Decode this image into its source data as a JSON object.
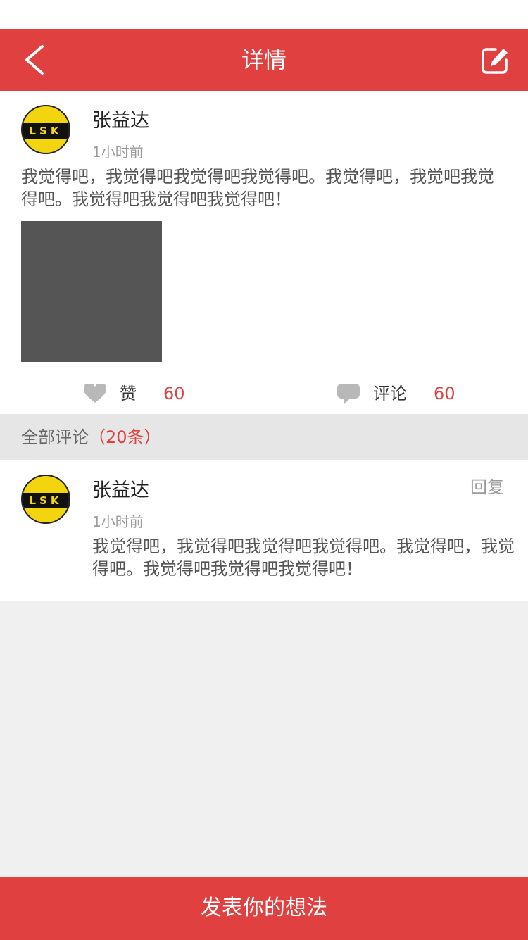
{
  "header": {
    "title": "详情",
    "back_icon": "chevron-left-icon",
    "edit_icon": "edit-icon"
  },
  "post": {
    "author": "张益达",
    "time": "1小时前",
    "avatar_text": "LSK",
    "text": "我觉得吧，我觉得吧我觉得吧我觉得吧。我觉得吧，我觉吧我觉得吧。我觉得吧我觉得吧我觉得吧！"
  },
  "actions": {
    "like_label": "赞",
    "like_count": "60",
    "comment_label": "评论",
    "comment_count": "60"
  },
  "comments_section": {
    "title": "全部评论",
    "count": "（20条）"
  },
  "comments": [
    {
      "author": "张益达",
      "time": "1小时前",
      "avatar_text": "LSK",
      "reply_label": "回复",
      "text": "我觉得吧，我觉得吧我觉得吧我觉得吧。我觉得吧，我觉得吧。我觉得吧我觉得吧我觉得吧！"
    }
  ],
  "footer": {
    "button_label": "发表你的想法"
  },
  "colors": {
    "brand": "#e04040",
    "background": "#f0f0f0"
  }
}
